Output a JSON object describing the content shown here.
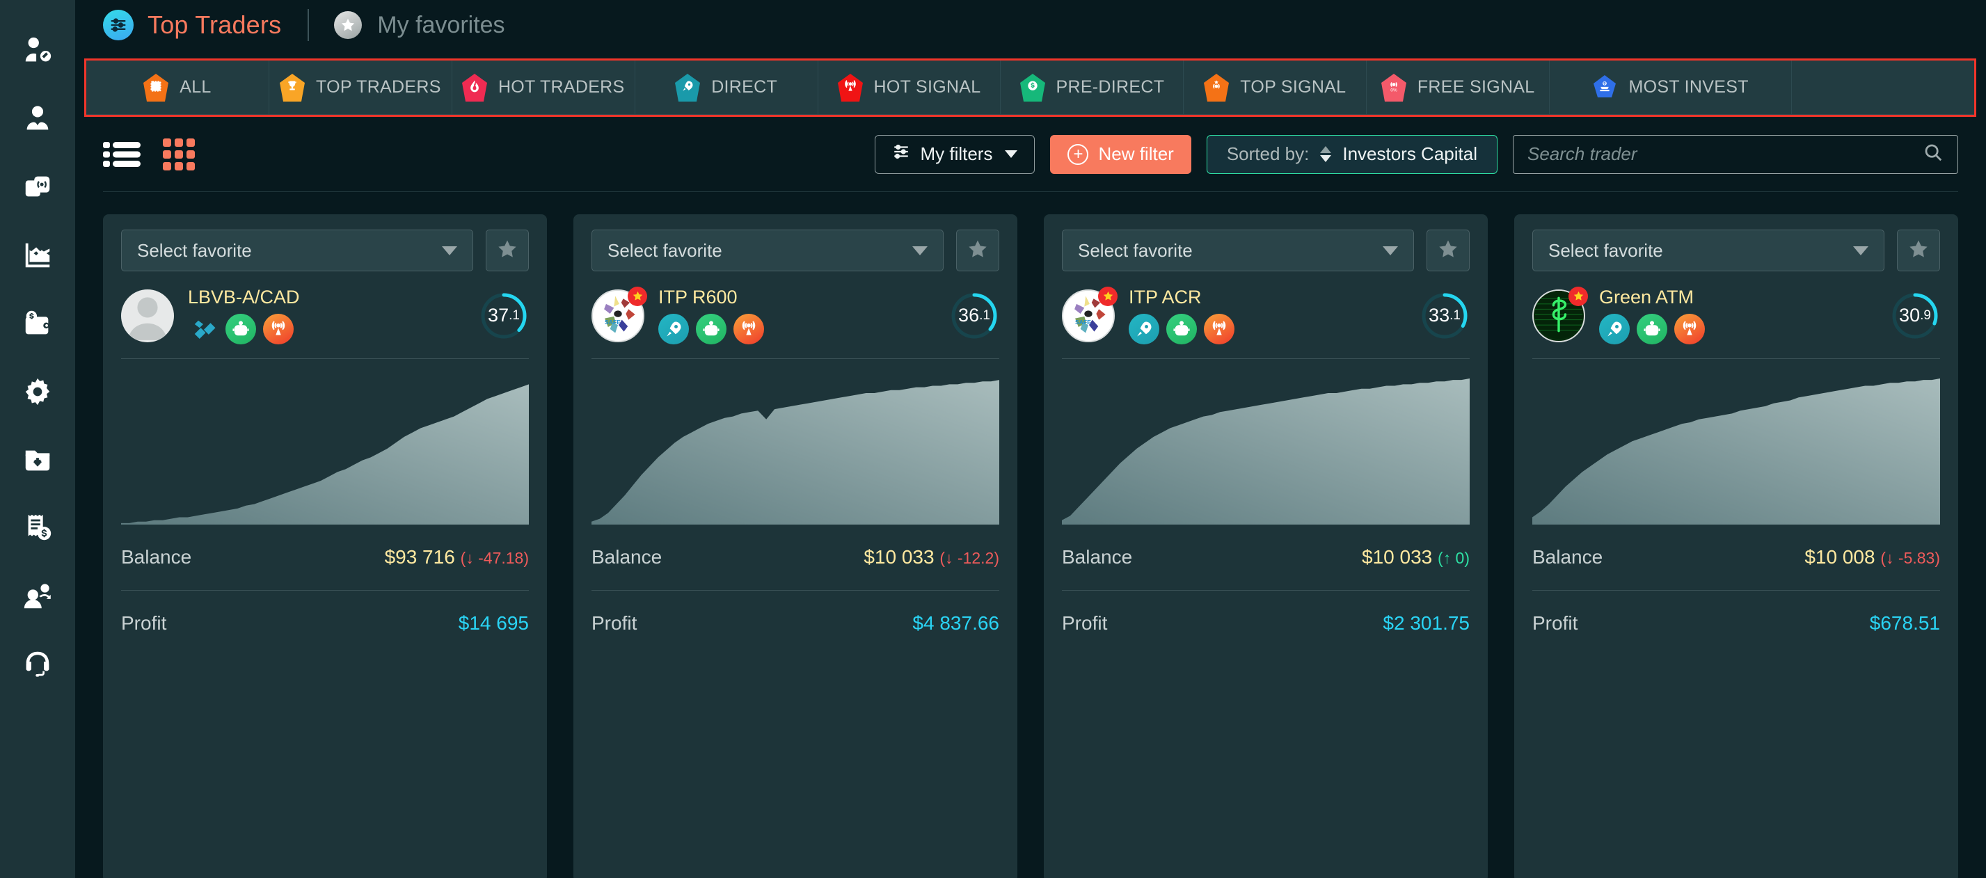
{
  "sidebar": {
    "items": [
      {
        "name": "trader-account-icon",
        "icon": "user-card"
      },
      {
        "name": "users-icon",
        "icon": "users"
      },
      {
        "name": "signals-icon",
        "icon": "signal-cards"
      },
      {
        "name": "chart-icon",
        "icon": "area-chart"
      },
      {
        "name": "wallet-icon",
        "icon": "wallet"
      },
      {
        "name": "settings-icon",
        "icon": "gear"
      },
      {
        "name": "deposit-icon",
        "icon": "folder-download"
      },
      {
        "name": "billing-icon",
        "icon": "invoice-dollar"
      },
      {
        "name": "referrals-icon",
        "icon": "user-share"
      },
      {
        "name": "support-icon",
        "icon": "headset"
      }
    ]
  },
  "header": {
    "brand_icon": "sliders-icon",
    "title": "Top Traders",
    "favorites_icon": "star-circle-icon",
    "favorites_label": "My favorites",
    "accent_color": "#f87a5e"
  },
  "tabs": [
    {
      "label": "ALL",
      "icon": "pentagon-all-icon",
      "color": "#f47216"
    },
    {
      "label": "TOP TRADERS",
      "icon": "pentagon-trophy-icon",
      "color": "#f9a526"
    },
    {
      "label": "HOT TRADERS",
      "icon": "pentagon-flame-icon",
      "color": "#ef2b52"
    },
    {
      "label": "DIRECT",
      "icon": "pentagon-rocket-icon",
      "color": "#1a9aaa"
    },
    {
      "label": "HOT SIGNAL",
      "icon": "pentagon-signal-icon",
      "color": "#f01414"
    },
    {
      "label": "PRE-DIRECT",
      "icon": "pentagon-dollar-icon",
      "color": "#16b87a"
    },
    {
      "label": "TOP SIGNAL",
      "icon": "pentagon-top-signal-icon",
      "color": "#f47216"
    },
    {
      "label": "FREE SIGNAL",
      "icon": "pentagon-free-signal-icon",
      "color": "#f45a6a"
    },
    {
      "label": "MOST INVEST",
      "icon": "pentagon-invest-icon",
      "color": "#2f6fe8"
    }
  ],
  "toolbar": {
    "view_list_icon": "list-view-icon",
    "view_grid_icon": "grid-view-icon",
    "active_view": "grid",
    "my_filters_label": "My filters",
    "new_filter_label": "New filter",
    "sorted_by_label": "Sorted by:",
    "sorted_by_value": "Investors Capital",
    "search_placeholder": "Search trader",
    "search_value": ""
  },
  "cards": [
    {
      "select_favorite": "Select favorite",
      "star_icon": "star-icon",
      "avatar": "default-person",
      "has_badge_star": false,
      "name": "LBVB-A/CAD",
      "badges": [
        "diamond-icon",
        "robot-icon",
        "broadcast-icon"
      ],
      "rating": "37",
      "rating_decimal": ".1",
      "rating_pct": 37,
      "balance_label": "Balance",
      "balance_value": "$93 716",
      "balance_delta": "(↓ -47.18)",
      "balance_delta_dir": "down",
      "profit_label": "Profit",
      "profit_value": "$14 695"
    },
    {
      "select_favorite": "Select favorite",
      "star_icon": "star-icon",
      "avatar": "safe-arrows",
      "has_badge_star": true,
      "name": "ITP R600",
      "badges": [
        "rocket-icon",
        "robot-icon",
        "broadcast-icon"
      ],
      "rating": "36",
      "rating_decimal": ".1",
      "rating_pct": 36,
      "balance_label": "Balance",
      "balance_value": "$10 033",
      "balance_delta": "(↓ -12.2)",
      "balance_delta_dir": "down",
      "profit_label": "Profit",
      "profit_value": "$4 837.66"
    },
    {
      "select_favorite": "Select favorite",
      "star_icon": "star-icon",
      "avatar": "safe-arrows",
      "has_badge_star": true,
      "name": "ITP ACR",
      "badges": [
        "rocket-icon",
        "robot-icon",
        "broadcast-icon"
      ],
      "rating": "33",
      "rating_decimal": ".1",
      "rating_pct": 33,
      "balance_label": "Balance",
      "balance_value": "$10 033",
      "balance_delta": "(↑ 0)",
      "balance_delta_dir": "up",
      "profit_label": "Profit",
      "profit_value": "$2 301.75"
    },
    {
      "select_favorite": "Select favorite",
      "star_icon": "star-icon",
      "avatar": "green-dollar",
      "has_badge_star": true,
      "name": "Green ATM",
      "badges": [
        "rocket-icon",
        "robot-icon",
        "broadcast-icon"
      ],
      "rating": "30",
      "rating_decimal": ".9",
      "rating_pct": 31,
      "balance_label": "Balance",
      "balance_value": "$10 008",
      "balance_delta": "(↓ -5.83)",
      "balance_delta_dir": "down",
      "profit_label": "Profit",
      "profit_value": "$678.51"
    }
  ],
  "chart_data": {
    "type": "area",
    "title": "",
    "xlabel": "",
    "ylabel": "",
    "series": [
      {
        "name": "LBVB-A/CAD equity",
        "values": [
          1,
          1,
          2,
          2,
          3,
          3,
          4,
          5,
          5,
          6,
          7,
          8,
          9,
          10,
          11,
          13,
          14,
          16,
          18,
          20,
          22,
          24,
          26,
          28,
          30,
          33,
          36,
          38,
          41,
          44,
          46,
          49,
          52,
          56,
          60,
          63,
          66,
          68,
          70,
          72,
          74,
          77,
          80,
          83,
          86,
          88,
          90,
          92,
          94,
          96
        ]
      },
      {
        "name": "ITP R600 equity",
        "values": [
          2,
          4,
          8,
          14,
          20,
          27,
          34,
          40,
          46,
          51,
          56,
          60,
          63,
          66,
          69,
          71,
          73,
          74,
          76,
          77,
          78,
          72,
          79,
          80,
          81,
          82,
          83,
          84,
          85,
          86,
          87,
          88,
          89,
          90,
          90,
          91,
          92,
          92,
          93,
          94,
          94,
          95,
          95,
          96,
          96,
          97,
          97,
          98,
          98,
          99
        ]
      },
      {
        "name": "ITP ACR equity",
        "values": [
          3,
          6,
          12,
          18,
          24,
          30,
          36,
          42,
          47,
          52,
          56,
          60,
          63,
          66,
          68,
          70,
          72,
          74,
          75,
          77,
          78,
          79,
          80,
          81,
          82,
          83,
          84,
          85,
          86,
          87,
          88,
          89,
          90,
          90,
          91,
          92,
          93,
          93,
          94,
          95,
          95,
          96,
          96,
          97,
          97,
          98,
          98,
          99,
          99,
          100
        ]
      },
      {
        "name": "Green ATM equity",
        "values": [
          5,
          9,
          14,
          20,
          26,
          31,
          36,
          40,
          44,
          48,
          51,
          54,
          57,
          59,
          61,
          63,
          65,
          67,
          69,
          70,
          72,
          73,
          74,
          75,
          76,
          78,
          79,
          80,
          81,
          83,
          84,
          85,
          87,
          88,
          89,
          90,
          91,
          92,
          93,
          94,
          95,
          95,
          96,
          97,
          97,
          98,
          98,
          99,
          99,
          100
        ]
      }
    ],
    "ylim": [
      0,
      100
    ],
    "grid": false,
    "legend": "none",
    "fill_color": "#8fa9ab"
  }
}
